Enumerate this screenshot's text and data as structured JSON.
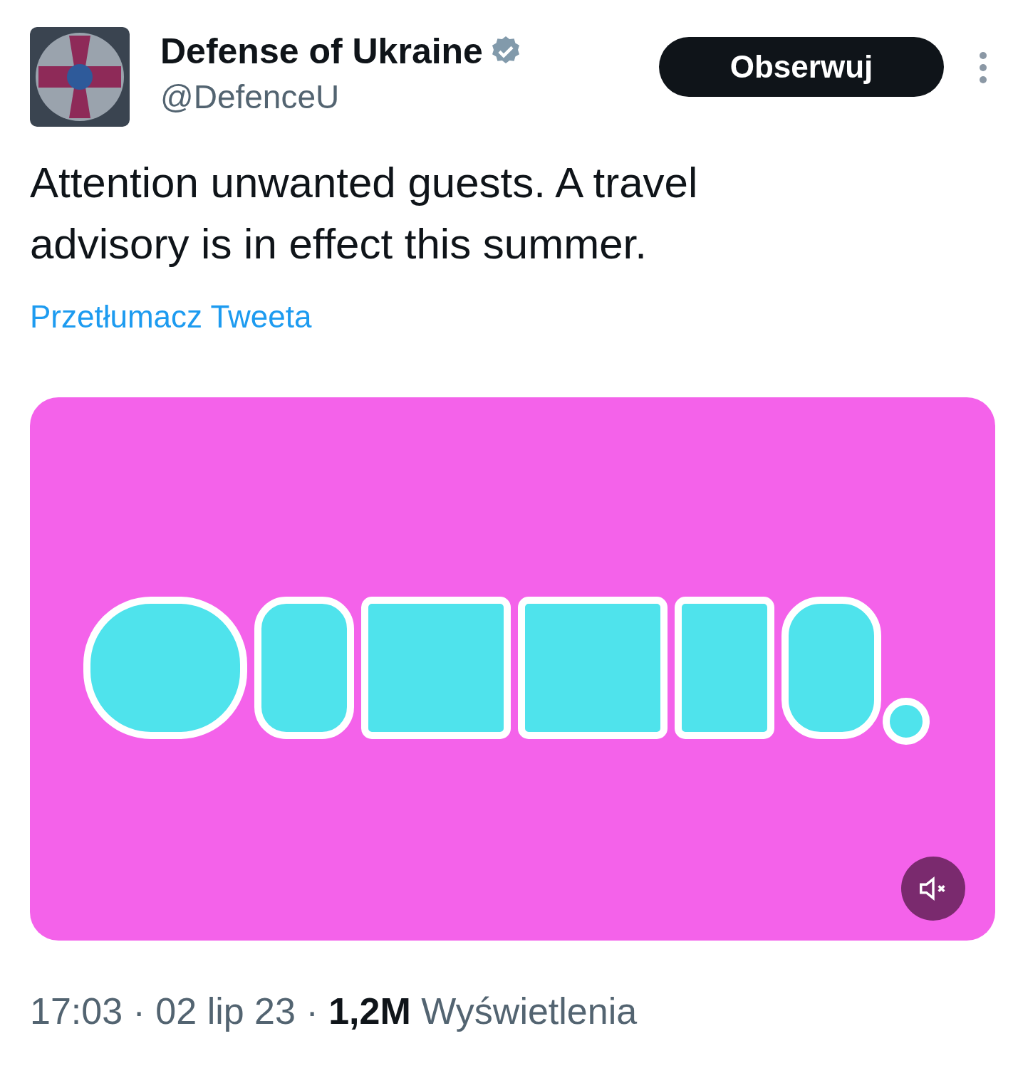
{
  "author": {
    "name": "Defense of Ukraine",
    "verified": true,
    "handle": "@DefenceU"
  },
  "follow_button": "Obserwuj",
  "text": "Attention unwanted guests. A travel advisory is in effect this summer.",
  "translate_link": "Przetłumacz Tweeta",
  "media": {
    "kind": "picture",
    "muted": true
  },
  "footer": "17:03 · 02 lip 23 · **1,2M** Wyświetlenia"
}
